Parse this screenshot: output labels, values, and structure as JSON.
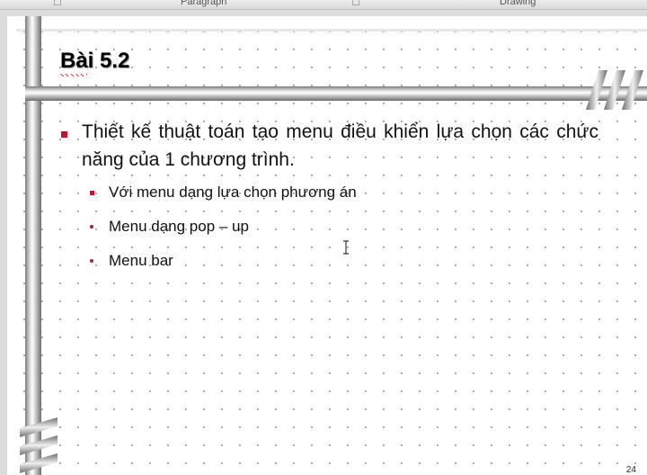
{
  "ribbon": {
    "group_paragraph": "Paragraph",
    "group_drawing": "Drawing"
  },
  "slide": {
    "title": "Bài 5.2",
    "bullet_main": "Thiết kế thuật toán tạo menu điều khiển lựa chọn các chức năng của 1 chương trình.",
    "sub_bullets": [
      "Với menu dạng lựa chọn phương án",
      "Menu dạng pop – up",
      "Menu bar"
    ],
    "page_number": "24"
  },
  "colors": {
    "bullet": "#b01c33",
    "background": "#ffffff",
    "grid_dots": "#9a9a9a"
  },
  "icons": {
    "cursor": "text-cursor-icon",
    "launcher": "dialog-launcher-icon"
  }
}
